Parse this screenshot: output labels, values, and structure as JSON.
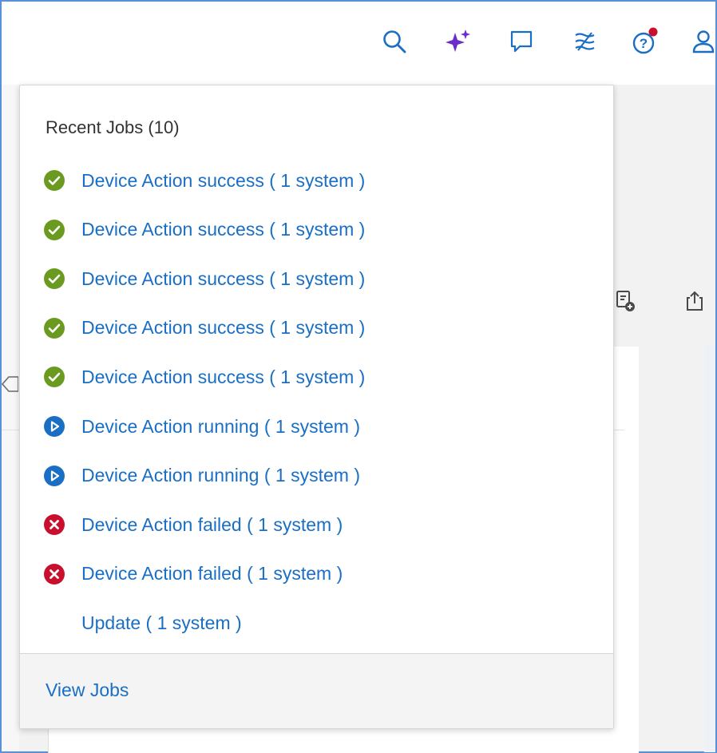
{
  "colors": {
    "link": "#1a6fc4",
    "success": "#6a9a1f",
    "running": "#1a6fc4",
    "failed": "#c8102e",
    "notification_dot": "#c8102e",
    "ai_icon": "#6b2fc9"
  },
  "header": {
    "icons": [
      "search-icon",
      "ai-sparkle-icon",
      "chat-icon",
      "task-stack-icon",
      "help-icon",
      "user-icon"
    ]
  },
  "recent_jobs": {
    "title": "Recent Jobs (10)",
    "items": [
      {
        "label": "Device Action success ( 1 system )",
        "status": "success"
      },
      {
        "label": "Device Action success ( 1 system )",
        "status": "success"
      },
      {
        "label": "Device Action success ( 1 system )",
        "status": "success"
      },
      {
        "label": "Device Action success ( 1 system )",
        "status": "success"
      },
      {
        "label": "Device Action success ( 1 system )",
        "status": "success"
      },
      {
        "label": "Device Action running ( 1 system )",
        "status": "running"
      },
      {
        "label": "Device Action running ( 1 system )",
        "status": "running"
      },
      {
        "label": "Device Action failed ( 1 system )",
        "status": "failed"
      },
      {
        "label": "Device Action failed ( 1 system )",
        "status": "failed"
      },
      {
        "label": "Update ( 1 system )",
        "status": "none"
      }
    ],
    "footer_link": "View Jobs"
  }
}
